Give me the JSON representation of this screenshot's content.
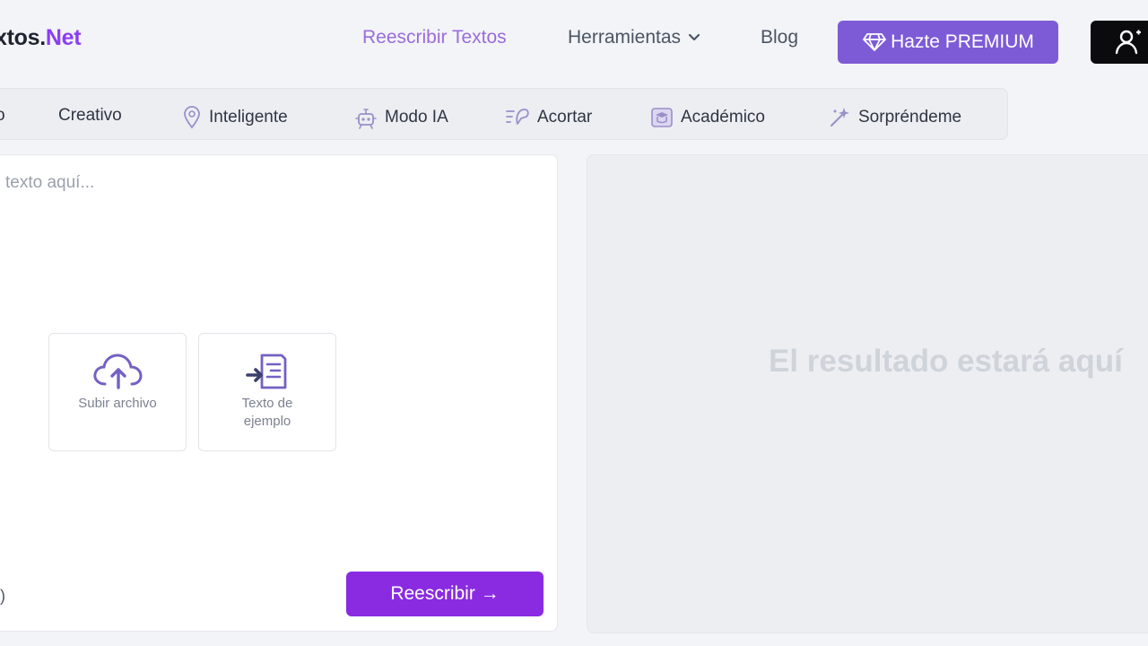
{
  "header": {
    "logo_part1": "xtos.",
    "logo_part2": "Net",
    "nav": {
      "rewrite": "Reescribir Textos",
      "tools": "Herramientas",
      "blog": "Blog"
    },
    "premium_label": "Hazte PREMIUM"
  },
  "modes": {
    "partial": "o",
    "creative": "Creativo",
    "intelligent": "Inteligente",
    "ai_mode": "Modo IA",
    "shorten": "Acortar",
    "academic": "Académico",
    "surprise": "Sorpréndeme"
  },
  "input": {
    "placeholder": "texto aquí...",
    "upload_label": "Subir archivo",
    "sample_label": "Texto de ejemplo",
    "char_count": "s)",
    "rewrite_button": "Reescribir →"
  },
  "output": {
    "placeholder": "El resultado estará aquí"
  },
  "colors": {
    "accent": "#8a2be2",
    "premium": "#7e5bd6",
    "nav_active": "#9a6cdb"
  }
}
